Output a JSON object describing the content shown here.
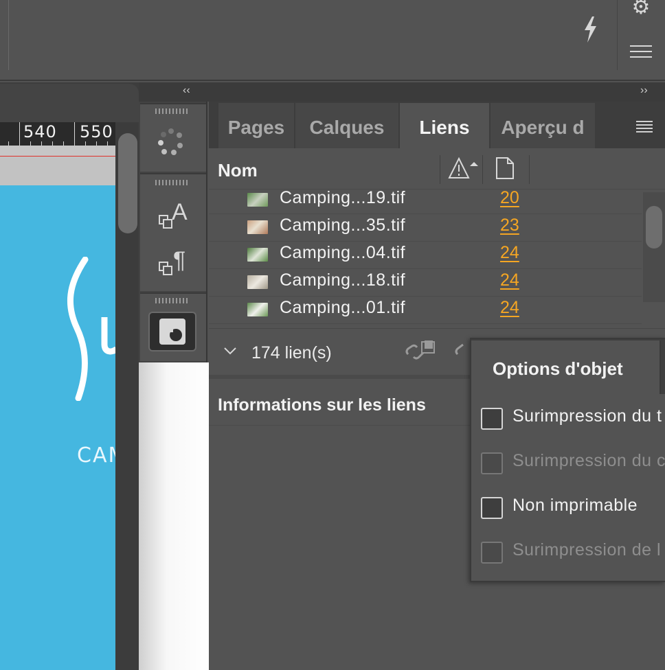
{
  "toolbar": {
    "bolt_icon": "lightning-bolt-icon",
    "gear_icon": "gear-icon",
    "menu_icon": "hamburger-menu-icon"
  },
  "ruler": {
    "labels": [
      "540",
      "550"
    ]
  },
  "document": {
    "visible_text": "CAM"
  },
  "collapse": {
    "left": "‹‹",
    "right": "››"
  },
  "tabs": [
    {
      "label": "Pages",
      "active": false
    },
    {
      "label": "Calques",
      "active": false
    },
    {
      "label": "Liens",
      "active": true
    },
    {
      "label": "Aperçu d",
      "active": false
    }
  ],
  "links_panel": {
    "col_name": "Nom",
    "status_icon": "warning-triangle-sort-icon",
    "page_icon": "page-icon",
    "rows": [
      {
        "name": "Camping...19.tif",
        "page": "20"
      },
      {
        "name": "Camping...35.tif",
        "page": "23"
      },
      {
        "name": "Camping...04.tif",
        "page": "24"
      },
      {
        "name": "Camping...18.tif",
        "page": "24"
      },
      {
        "name": "Camping...01.tif",
        "page": "24"
      }
    ],
    "count": "174 lien(s)",
    "info_title": "Informations sur les liens"
  },
  "object_options": {
    "title": "Options d'objet",
    "items": [
      {
        "label": "Surimpression du t",
        "enabled": true,
        "checked": false
      },
      {
        "label": "Surimpression du c",
        "enabled": false,
        "checked": false
      },
      {
        "label": "Non imprimable",
        "enabled": true,
        "checked": false
      },
      {
        "label": "Surimpression de l",
        "enabled": false,
        "checked": false
      }
    ]
  },
  "colors": {
    "link_page": "#f5a623",
    "document_bg": "#45b7e0",
    "panel_bg": "#535353"
  }
}
